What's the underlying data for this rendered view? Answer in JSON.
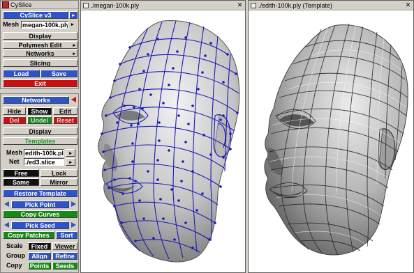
{
  "cyslice": {
    "app_title": "CySlice",
    "version_button": "CySlice v3",
    "mesh_label": "Mesh",
    "mesh_value": "megan-100k.ply",
    "display": "Display",
    "polymesh_edit": "Polymesh Edit",
    "networks": "Networks",
    "slicing": "Slicing",
    "load": "Load",
    "save": "Save",
    "exit": "Exit"
  },
  "networks_panel": {
    "title": "Networks",
    "hide": "Hide",
    "show": "Show",
    "edit": "Edit",
    "del": "Del",
    "undel": "Undel",
    "reset": "Reset",
    "display": "Display",
    "templates": "Templates",
    "mesh_label": "Mesh",
    "mesh_value": "edith-100k.ply",
    "net_label": "Net",
    "net_value": "./ed3.slice",
    "free": "Free",
    "lock": "Lock",
    "same": "Same",
    "mirror": "Mirror",
    "restore_template": "Restore Template",
    "pick_point": "Pick Point",
    "copy_curves": "Copy Curves",
    "pick_seed": "Pick Seed",
    "copy_patches": "Copy Patches",
    "sort": "Sort",
    "scale_label": "Scale",
    "fixed": "Fixed",
    "viewer": "Viewer",
    "group_label": "Group",
    "align": "Align",
    "refine": "Refine",
    "copy_label": "Copy",
    "points": "Points",
    "seeds": "Seeds"
  },
  "viewers": {
    "left_title": "./megan-100k.ply",
    "right_title": "./edith-100k.ply (Template)"
  },
  "colors": {
    "button_blue": "#2e54c8",
    "button_red": "#cc1010",
    "button_green": "#168a16",
    "mesh_curve_blue": "#1a1ab4"
  }
}
